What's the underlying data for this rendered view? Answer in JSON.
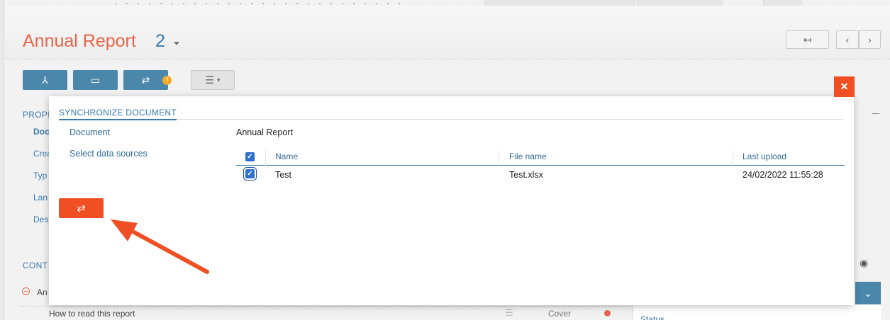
{
  "header": {
    "title": "Annual Report",
    "version": "2",
    "back_icon": "↤",
    "prev_icon": "‹",
    "next_icon": "›"
  },
  "toolbar": {
    "pdf_icon": "⅄",
    "preview_icon": "▭",
    "sync_icon": "⇄",
    "warning_badge": "!",
    "menu_icon": "☰"
  },
  "background": {
    "properties_section": "PROPE",
    "properties_items": [
      "Doc",
      "Crea",
      "Typ",
      "Lan",
      "Des"
    ],
    "contents_section": "CONT",
    "contents_root": "An",
    "contents_row_title": "How to read this report",
    "contents_row_type": "Cover",
    "status_label": "Status"
  },
  "modal": {
    "title": "SYNCHRONIZE DOCUMENT",
    "nav": [
      "Document",
      "Select data sources"
    ],
    "document_name": "Annual Report",
    "table": {
      "headers": [
        "Name",
        "File name",
        "Last upload"
      ],
      "rows": [
        {
          "checked": true,
          "name": "Test",
          "file_name": "Test.xlsx",
          "last_upload": "24/02/2022 11:55:28"
        }
      ]
    },
    "sync_button_icon": "⇄",
    "close_icon": "×"
  },
  "colors": {
    "accent_orange": "#f04e23",
    "title_orange": "#e8644a",
    "primary_blue": "#4a87ab",
    "link_blue": "#3a7ab0",
    "checkbox_blue": "#2f6fcf",
    "arrow": "#f04e23"
  }
}
